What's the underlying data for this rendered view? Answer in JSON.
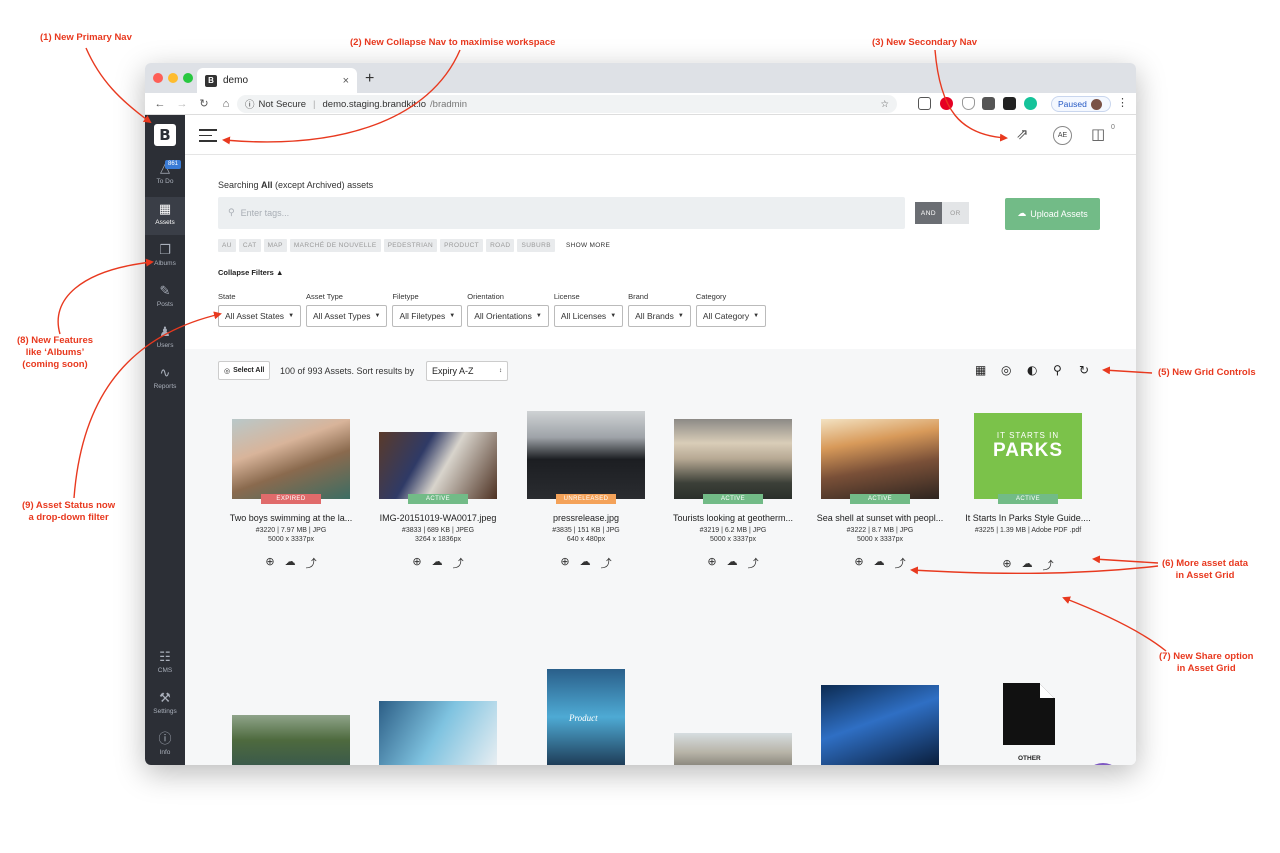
{
  "annotations": {
    "a1": "(1) New Primary Nav",
    "a2": "(2) New Collapse Nav to maximise workspace",
    "a3": "(3) New Secondary Nav",
    "a5": "(5)  New Grid Controls",
    "a6_line1": "(6)  More asset data",
    "a6_line2": "in Asset Grid",
    "a7_line1": "(7)  New Share option",
    "a7_line2": "in Asset Grid",
    "a8_line1": "(8)  New Features",
    "a8_line2": "like ‘Albums’",
    "a8_line3": "(coming soon)",
    "a9_line1": "(9) Asset Status now",
    "a9_line2": "a drop-down filter"
  },
  "browser": {
    "tab_title": "demo",
    "tab_close": "×",
    "new_tab": "+",
    "security": "Not Secure",
    "url_host": "demo.staging.brandkit.io",
    "url_path": "/bradmin",
    "profile_label": "Paused"
  },
  "sidebar": {
    "logo": "B",
    "todo_badge": "861",
    "items": [
      {
        "label": "To Do",
        "icon": "warning-icon"
      },
      {
        "label": "Assets",
        "icon": "grid-icon"
      },
      {
        "label": "Albums",
        "icon": "albums-icon"
      },
      {
        "label": "Posts",
        "icon": "edit-icon"
      },
      {
        "label": "Users",
        "icon": "users-icon"
      },
      {
        "label": "Reports",
        "icon": "pulse-icon"
      },
      {
        "label": "CMS",
        "icon": "cms-icon"
      },
      {
        "label": "Settings",
        "icon": "wrench-icon"
      },
      {
        "label": "Info",
        "icon": "info-icon"
      }
    ]
  },
  "topbar": {
    "avatar_initials": "AE",
    "cart_count": "0"
  },
  "search": {
    "prefix": "Searching ",
    "scope": "All",
    "suffix": " (except Archived) assets",
    "placeholder": "Enter tags...",
    "and_label": "AND",
    "or_label": "OR",
    "upload_label": "Upload Assets",
    "tags": [
      "AU",
      "CAT",
      "MAP",
      "MARCHÉ DE NOUVELLE",
      "PEDESTRIAN",
      "PRODUCT",
      "ROAD",
      "SUBURB"
    ],
    "show_more": "SHOW MORE",
    "collapse_filters": "Collapse Filters"
  },
  "filters": [
    {
      "label": "State",
      "value": "All Asset States"
    },
    {
      "label": "Asset Type",
      "value": "All Asset Types"
    },
    {
      "label": "Filetype",
      "value": "All Filetypes"
    },
    {
      "label": "Orientation",
      "value": "All Orientations"
    },
    {
      "label": "License",
      "value": "All Licenses"
    },
    {
      "label": "Brand",
      "value": "All Brands"
    },
    {
      "label": "Category",
      "value": "All Category"
    }
  ],
  "grid": {
    "select_all": "Select All",
    "count_text": "100 of 993 Assets. Sort results by",
    "sort_value": "Expiry A-Z"
  },
  "assets": [
    {
      "name": "Two boys swimming at the la...",
      "meta": "#3220 | 7.97 MB | JPG",
      "dims": "5000 x 3337px",
      "status": "EXPIRED",
      "status_color": "#e06b6b"
    },
    {
      "name": "IMG-20151019-WA0017.jpeg",
      "meta": "#3833 | 689 KB | JPEG",
      "dims": "3264 x 1836px",
      "status": "ACTIVE",
      "status_color": "#72bb87"
    },
    {
      "name": "pressrelease.jpg",
      "meta": "#3835 | 151 KB | JPG",
      "dims": "640 x 480px",
      "status": "UNRELEASED",
      "status_color": "#f4a259"
    },
    {
      "name": "Tourists looking at geotherm...",
      "meta": "#3219 | 6.2 MB | JPG",
      "dims": "5000 x 3337px",
      "status": "ACTIVE",
      "status_color": "#72bb87"
    },
    {
      "name": "Sea shell at sunset with peopl...",
      "meta": "#3222 | 8.7 MB | JPG",
      "dims": "5000 x 3337px",
      "status": "ACTIVE",
      "status_color": "#72bb87"
    },
    {
      "name": "It Starts In Parks Style Guide....",
      "meta": "#3225 | 1.39 MB | Adobe PDF .pdf",
      "dims": "",
      "status": "ACTIVE",
      "status_color": "#72bb87",
      "cover_line1": "IT STARTS IN",
      "cover_line2": "PARKS"
    }
  ],
  "row2": {
    "other_label": "OTHER",
    "product_text": "Product"
  },
  "colors": {
    "accent_green": "#72bb87",
    "sidebar_bg": "#2c2f36",
    "annotation_red": "#e8391f",
    "chat_purple": "#7e58c2"
  }
}
